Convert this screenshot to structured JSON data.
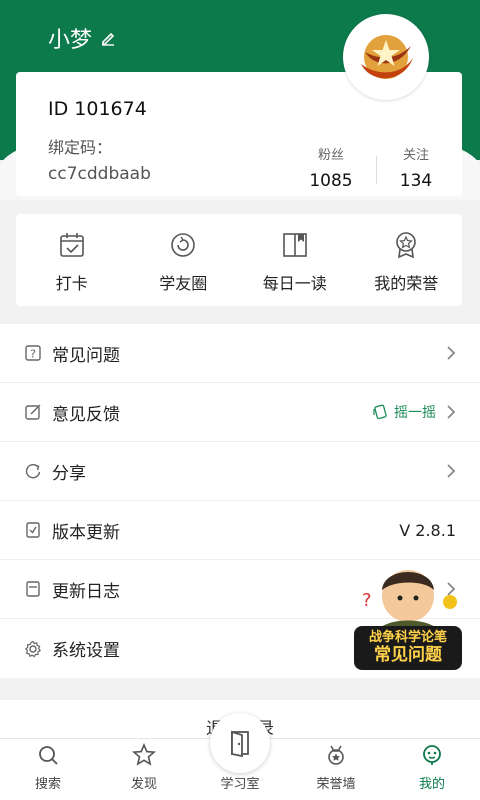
{
  "profile": {
    "username": "小梦",
    "uid": "ID 101674",
    "bind_label": "绑定码：",
    "bind_code": "cc7cddbaab",
    "fans_label": "粉丝",
    "fans_value": "1085",
    "follow_label": "关注",
    "follow_value": "134"
  },
  "quick_actions": [
    {
      "label": "打卡",
      "icon": "calendar-check-icon"
    },
    {
      "label": "学友圈",
      "icon": "circle-refresh-icon"
    },
    {
      "label": "每日一读",
      "icon": "book-icon"
    },
    {
      "label": "我的荣誉",
      "icon": "medal-icon"
    }
  ],
  "menu": [
    {
      "label": "常见问题",
      "icon": "question-icon"
    },
    {
      "label": "意见反馈",
      "icon": "edit-icon",
      "extra": "摇一摇"
    },
    {
      "label": "分享",
      "icon": "share-icon"
    },
    {
      "label": "版本更新",
      "icon": "update-icon",
      "version": "V 2.8.1"
    },
    {
      "label": "更新日志",
      "icon": "log-icon"
    },
    {
      "label": "系统设置",
      "icon": "gear-icon"
    }
  ],
  "logout": "退出登录",
  "tabs": [
    {
      "label": "搜索",
      "icon": "search-icon"
    },
    {
      "label": "发现",
      "icon": "star-icon"
    },
    {
      "label": "学习室",
      "icon": "door-icon"
    },
    {
      "label": "荣誉墙",
      "icon": "medal-icon"
    },
    {
      "label": "我的",
      "icon": "user-icon",
      "active": true
    }
  ],
  "floater": {
    "line1": "战争科学论笔",
    "line2": "常见问题"
  },
  "colors": {
    "primary": "#0d7a4c",
    "accent": "#1a8a57"
  }
}
